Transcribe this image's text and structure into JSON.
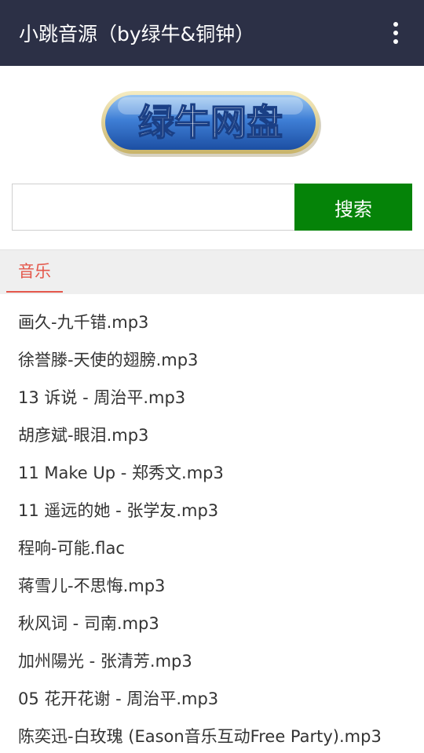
{
  "appbar": {
    "title": "小跳音源（by绿牛&铜钟）",
    "menu_icon": "more-vert-icon",
    "background": "#2c3046"
  },
  "logo": {
    "text": "绿牛网盘"
  },
  "search": {
    "placeholder": "",
    "value": "",
    "button_label": "搜索",
    "button_color": "#058308"
  },
  "tabs": [
    {
      "label": "音乐",
      "active": true,
      "color": "#e4574b"
    }
  ],
  "files": [
    {
      "name": "画久-九千错.mp3"
    },
    {
      "name": "徐誉滕-天使的翅膀.mp3"
    },
    {
      "name": "13 诉说 - 周治平.mp3"
    },
    {
      "name": "胡彦斌-眼泪.mp3"
    },
    {
      "name": "11 Make Up - 郑秀文.mp3"
    },
    {
      "name": "11 遥远的她 - 张学友.mp3"
    },
    {
      "name": "程响-可能.flac"
    },
    {
      "name": "蒋雪儿-不思悔.mp3"
    },
    {
      "name": "秋风词 - 司南.mp3"
    },
    {
      "name": "加州陽光 - 张清芳.mp3"
    },
    {
      "name": "05 花开花谢 - 周治平.mp3"
    },
    {
      "name": "陈奕迅-白玫瑰 (Eason音乐互动Free Party).mp3"
    }
  ]
}
